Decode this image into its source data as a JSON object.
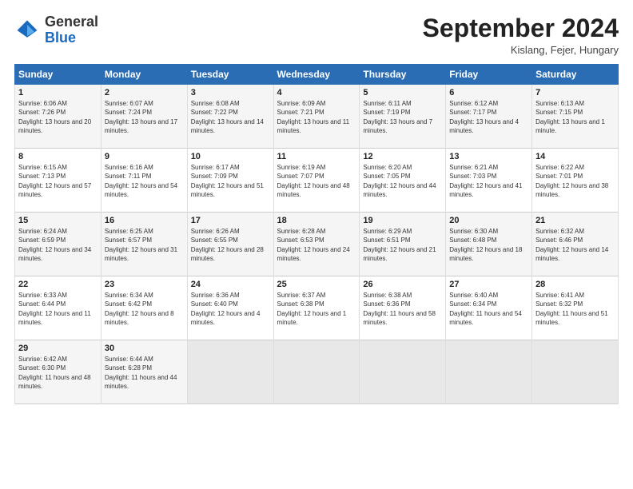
{
  "header": {
    "logo_general": "General",
    "logo_blue": "Blue",
    "month_title": "September 2024",
    "location": "Kislang, Fejer, Hungary"
  },
  "days_of_week": [
    "Sunday",
    "Monday",
    "Tuesday",
    "Wednesday",
    "Thursday",
    "Friday",
    "Saturday"
  ],
  "weeks": [
    [
      {
        "day": "1",
        "sunrise": "Sunrise: 6:06 AM",
        "sunset": "Sunset: 7:26 PM",
        "daylight": "Daylight: 13 hours and 20 minutes."
      },
      {
        "day": "2",
        "sunrise": "Sunrise: 6:07 AM",
        "sunset": "Sunset: 7:24 PM",
        "daylight": "Daylight: 13 hours and 17 minutes."
      },
      {
        "day": "3",
        "sunrise": "Sunrise: 6:08 AM",
        "sunset": "Sunset: 7:22 PM",
        "daylight": "Daylight: 13 hours and 14 minutes."
      },
      {
        "day": "4",
        "sunrise": "Sunrise: 6:09 AM",
        "sunset": "Sunset: 7:21 PM",
        "daylight": "Daylight: 13 hours and 11 minutes."
      },
      {
        "day": "5",
        "sunrise": "Sunrise: 6:11 AM",
        "sunset": "Sunset: 7:19 PM",
        "daylight": "Daylight: 13 hours and 7 minutes."
      },
      {
        "day": "6",
        "sunrise": "Sunrise: 6:12 AM",
        "sunset": "Sunset: 7:17 PM",
        "daylight": "Daylight: 13 hours and 4 minutes."
      },
      {
        "day": "7",
        "sunrise": "Sunrise: 6:13 AM",
        "sunset": "Sunset: 7:15 PM",
        "daylight": "Daylight: 13 hours and 1 minute."
      }
    ],
    [
      {
        "day": "8",
        "sunrise": "Sunrise: 6:15 AM",
        "sunset": "Sunset: 7:13 PM",
        "daylight": "Daylight: 12 hours and 57 minutes."
      },
      {
        "day": "9",
        "sunrise": "Sunrise: 6:16 AM",
        "sunset": "Sunset: 7:11 PM",
        "daylight": "Daylight: 12 hours and 54 minutes."
      },
      {
        "day": "10",
        "sunrise": "Sunrise: 6:17 AM",
        "sunset": "Sunset: 7:09 PM",
        "daylight": "Daylight: 12 hours and 51 minutes."
      },
      {
        "day": "11",
        "sunrise": "Sunrise: 6:19 AM",
        "sunset": "Sunset: 7:07 PM",
        "daylight": "Daylight: 12 hours and 48 minutes."
      },
      {
        "day": "12",
        "sunrise": "Sunrise: 6:20 AM",
        "sunset": "Sunset: 7:05 PM",
        "daylight": "Daylight: 12 hours and 44 minutes."
      },
      {
        "day": "13",
        "sunrise": "Sunrise: 6:21 AM",
        "sunset": "Sunset: 7:03 PM",
        "daylight": "Daylight: 12 hours and 41 minutes."
      },
      {
        "day": "14",
        "sunrise": "Sunrise: 6:22 AM",
        "sunset": "Sunset: 7:01 PM",
        "daylight": "Daylight: 12 hours and 38 minutes."
      }
    ],
    [
      {
        "day": "15",
        "sunrise": "Sunrise: 6:24 AM",
        "sunset": "Sunset: 6:59 PM",
        "daylight": "Daylight: 12 hours and 34 minutes."
      },
      {
        "day": "16",
        "sunrise": "Sunrise: 6:25 AM",
        "sunset": "Sunset: 6:57 PM",
        "daylight": "Daylight: 12 hours and 31 minutes."
      },
      {
        "day": "17",
        "sunrise": "Sunrise: 6:26 AM",
        "sunset": "Sunset: 6:55 PM",
        "daylight": "Daylight: 12 hours and 28 minutes."
      },
      {
        "day": "18",
        "sunrise": "Sunrise: 6:28 AM",
        "sunset": "Sunset: 6:53 PM",
        "daylight": "Daylight: 12 hours and 24 minutes."
      },
      {
        "day": "19",
        "sunrise": "Sunrise: 6:29 AM",
        "sunset": "Sunset: 6:51 PM",
        "daylight": "Daylight: 12 hours and 21 minutes."
      },
      {
        "day": "20",
        "sunrise": "Sunrise: 6:30 AM",
        "sunset": "Sunset: 6:48 PM",
        "daylight": "Daylight: 12 hours and 18 minutes."
      },
      {
        "day": "21",
        "sunrise": "Sunrise: 6:32 AM",
        "sunset": "Sunset: 6:46 PM",
        "daylight": "Daylight: 12 hours and 14 minutes."
      }
    ],
    [
      {
        "day": "22",
        "sunrise": "Sunrise: 6:33 AM",
        "sunset": "Sunset: 6:44 PM",
        "daylight": "Daylight: 12 hours and 11 minutes."
      },
      {
        "day": "23",
        "sunrise": "Sunrise: 6:34 AM",
        "sunset": "Sunset: 6:42 PM",
        "daylight": "Daylight: 12 hours and 8 minutes."
      },
      {
        "day": "24",
        "sunrise": "Sunrise: 6:36 AM",
        "sunset": "Sunset: 6:40 PM",
        "daylight": "Daylight: 12 hours and 4 minutes."
      },
      {
        "day": "25",
        "sunrise": "Sunrise: 6:37 AM",
        "sunset": "Sunset: 6:38 PM",
        "daylight": "Daylight: 12 hours and 1 minute."
      },
      {
        "day": "26",
        "sunrise": "Sunrise: 6:38 AM",
        "sunset": "Sunset: 6:36 PM",
        "daylight": "Daylight: 11 hours and 58 minutes."
      },
      {
        "day": "27",
        "sunrise": "Sunrise: 6:40 AM",
        "sunset": "Sunset: 6:34 PM",
        "daylight": "Daylight: 11 hours and 54 minutes."
      },
      {
        "day": "28",
        "sunrise": "Sunrise: 6:41 AM",
        "sunset": "Sunset: 6:32 PM",
        "daylight": "Daylight: 11 hours and 51 minutes."
      }
    ],
    [
      {
        "day": "29",
        "sunrise": "Sunrise: 6:42 AM",
        "sunset": "Sunset: 6:30 PM",
        "daylight": "Daylight: 11 hours and 48 minutes."
      },
      {
        "day": "30",
        "sunrise": "Sunrise: 6:44 AM",
        "sunset": "Sunset: 6:28 PM",
        "daylight": "Daylight: 11 hours and 44 minutes."
      },
      null,
      null,
      null,
      null,
      null
    ]
  ]
}
